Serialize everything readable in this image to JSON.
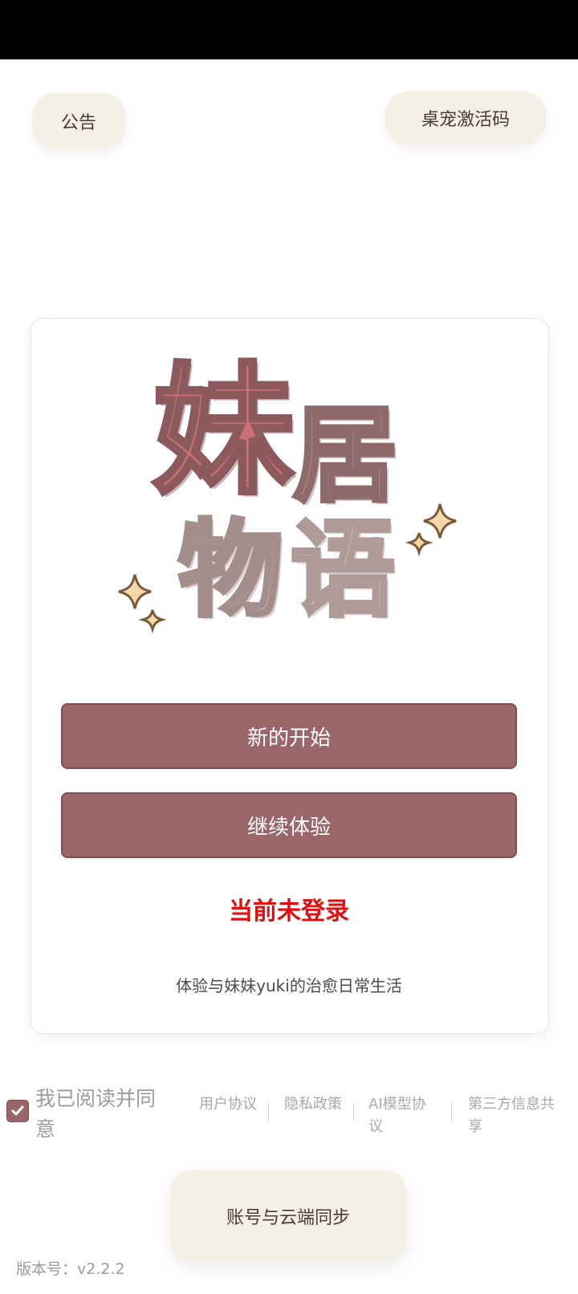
{
  "header": {
    "notice_label": "公告",
    "activation_code_label": "桌宠激活码"
  },
  "logo": {
    "chars": [
      "妹",
      "居",
      "物",
      "语"
    ]
  },
  "card": {
    "new_start_label": "新的开始",
    "continue_label": "继续体验",
    "login_status": "当前未登录",
    "tagline": "体验与妹妹yuki的治愈日常生活"
  },
  "agreement": {
    "checked": true,
    "agree_text": "我已阅读并同意",
    "links": [
      "用户协议",
      "隐私政策",
      "AI模型协议",
      "第三方信息共享"
    ]
  },
  "footer": {
    "sync_label": "账号与云端同步",
    "version": "版本号：v2.2.2"
  },
  "colors": {
    "primary_button": "#9a6669",
    "login_status": "#e01010",
    "pill_background": "#f5f0e6"
  },
  "icons": {
    "checkbox": "check-icon",
    "sparkles": "sparkle-icon"
  }
}
